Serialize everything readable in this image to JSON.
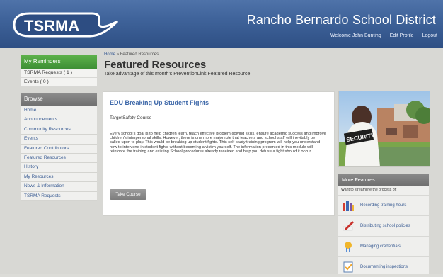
{
  "header": {
    "logo": "TSRMA",
    "district": "Rancho Bernardo School District",
    "welcome": "Welcome John Bunting",
    "edit_profile": "Edit Profile",
    "logout": "Logout"
  },
  "sidebar": {
    "reminders_title": "My Reminders",
    "reminders": [
      "TSRMA Requests ( 1 )",
      "Events ( 0 )"
    ],
    "browse_title": "Browse",
    "items": [
      "Home",
      "Announcements",
      "Community Resources",
      "Events",
      "Featured Contributors",
      "Featured Resources",
      "History",
      "My Resources",
      "News & Information",
      "TSRMA Requests"
    ]
  },
  "main": {
    "breadcrumb_home": "Home",
    "breadcrumb_sep": "»",
    "breadcrumb_current": "Featured Resources",
    "title": "Featured Resources",
    "subtitle": "Take advantage of this month's PreventionLink Featured Resource.",
    "resource": {
      "title": "EDU Breaking Up Student Fights",
      "subtitle": "TargetSafety Course",
      "body": "Every school's goal is to help children learn, teach effective problem-solving skills, ensure academic success and improve children's interpersonal skills. However, there is one more major role that teachers and school staff will inevitably be called upon to play. This would be breaking up student fights. This self-study training program will help you understand how to intervene in student fights without becoming a victim yourself. The information presented in this module will reinforce the training and existing School procedures already received and help you defuse a fight should it occur.",
      "button": "Take Course"
    }
  },
  "right": {
    "photo_label": "SECURITY",
    "features_title": "More Features",
    "features_subtitle": "Want to streamline the process of:",
    "features": [
      {
        "label": "Recording training hours",
        "icon": "books-icon"
      },
      {
        "label": "Distributing school policies",
        "icon": "pen-icon"
      },
      {
        "label": "Managing credentials",
        "icon": "medal-icon"
      },
      {
        "label": "Documenting inspections",
        "icon": "checklist-icon"
      }
    ]
  },
  "colors": {
    "header": "#3f639a",
    "green": "#4aa140",
    "link": "#3b5d94",
    "title_blue": "#3b66a8",
    "gray_bar": "#7c7c7c"
  }
}
